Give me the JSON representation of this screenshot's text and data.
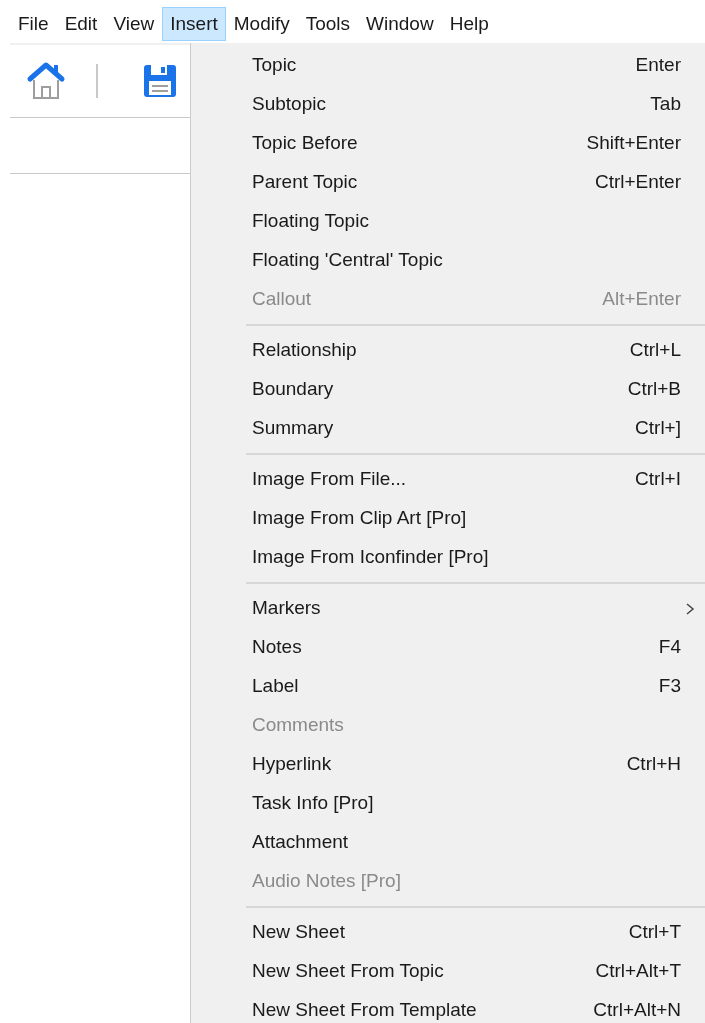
{
  "menubar": [
    {
      "label": "File",
      "selected": false
    },
    {
      "label": "Edit",
      "selected": false
    },
    {
      "label": "View",
      "selected": false
    },
    {
      "label": "Insert",
      "selected": true
    },
    {
      "label": "Modify",
      "selected": false
    },
    {
      "label": "Tools",
      "selected": false
    },
    {
      "label": "Window",
      "selected": false
    },
    {
      "label": "Help",
      "selected": false
    }
  ],
  "menu": {
    "groups": [
      [
        {
          "label": "Topic",
          "shortcut": "Enter",
          "disabled": false,
          "submenu": false
        },
        {
          "label": "Subtopic",
          "shortcut": "Tab",
          "disabled": false,
          "submenu": false
        },
        {
          "label": "Topic Before",
          "shortcut": "Shift+Enter",
          "disabled": false,
          "submenu": false
        },
        {
          "label": "Parent Topic",
          "shortcut": "Ctrl+Enter",
          "disabled": false,
          "submenu": false
        },
        {
          "label": "Floating Topic",
          "disabled": false,
          "submenu": false
        },
        {
          "label": "Floating 'Central' Topic",
          "disabled": false,
          "submenu": false
        },
        {
          "label": "Callout",
          "shortcut": "Alt+Enter",
          "disabled": true,
          "submenu": false
        }
      ],
      [
        {
          "label": "Relationship",
          "shortcut": "Ctrl+L",
          "disabled": false,
          "submenu": false
        },
        {
          "label": "Boundary",
          "shortcut": "Ctrl+B",
          "disabled": false,
          "submenu": false
        },
        {
          "label": "Summary",
          "shortcut": "Ctrl+]",
          "disabled": false,
          "submenu": false
        }
      ],
      [
        {
          "label": "Image From File...",
          "shortcut": "Ctrl+I",
          "disabled": false,
          "submenu": false
        },
        {
          "label": "Image From Clip Art [Pro]",
          "disabled": false,
          "submenu": false
        },
        {
          "label": "Image From Iconfinder [Pro]",
          "disabled": false,
          "submenu": false
        }
      ],
      [
        {
          "label": "Markers",
          "disabled": false,
          "submenu": true
        },
        {
          "label": "Notes",
          "shortcut": "F4",
          "disabled": false,
          "submenu": false
        },
        {
          "label": "Label",
          "shortcut": "F3",
          "disabled": false,
          "submenu": false
        },
        {
          "label": "Comments",
          "disabled": true,
          "submenu": false
        },
        {
          "label": "Hyperlink",
          "shortcut": "Ctrl+H",
          "disabled": false,
          "submenu": false
        },
        {
          "label": "Task Info [Pro]",
          "disabled": false,
          "submenu": false
        },
        {
          "label": "Attachment",
          "disabled": false,
          "submenu": false
        },
        {
          "label": "Audio Notes [Pro]",
          "disabled": true,
          "submenu": false
        }
      ],
      [
        {
          "label": "New Sheet",
          "shortcut": "Ctrl+T",
          "disabled": false,
          "submenu": false
        },
        {
          "label": "New Sheet From Topic",
          "shortcut": "Ctrl+Alt+T",
          "disabled": false,
          "submenu": false
        },
        {
          "label": "New Sheet From Template",
          "shortcut": "Ctrl+Alt+N",
          "disabled": false,
          "submenu": false
        }
      ]
    ]
  }
}
